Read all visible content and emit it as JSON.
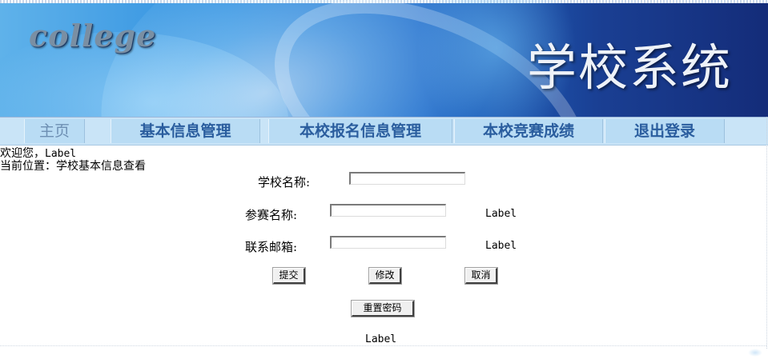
{
  "header": {
    "logo_text": "college",
    "system_title": "学校系统"
  },
  "nav": {
    "items": [
      {
        "label": "主页"
      },
      {
        "label": "基本信息管理"
      },
      {
        "label": "本校报名信息管理"
      },
      {
        "label": "本校竞赛成绩"
      },
      {
        "label": "退出登录"
      }
    ]
  },
  "welcome": {
    "prefix": "欢迎您，",
    "user_label": "Label"
  },
  "location": {
    "text": "当前位置：学校基本信息查看"
  },
  "form": {
    "school_name_label": "学校名称:",
    "school_name_value": "",
    "contest_name_label": "参赛名称:",
    "contest_name_value": "",
    "contest_name_status": "Label",
    "email_label": "联系邮箱:",
    "email_value": "",
    "email_status": "Label",
    "submit_label": "提交",
    "modify_label": "修改",
    "cancel_label": "取消",
    "reset_password_label": "重置密码",
    "footer_label": "Label"
  }
}
